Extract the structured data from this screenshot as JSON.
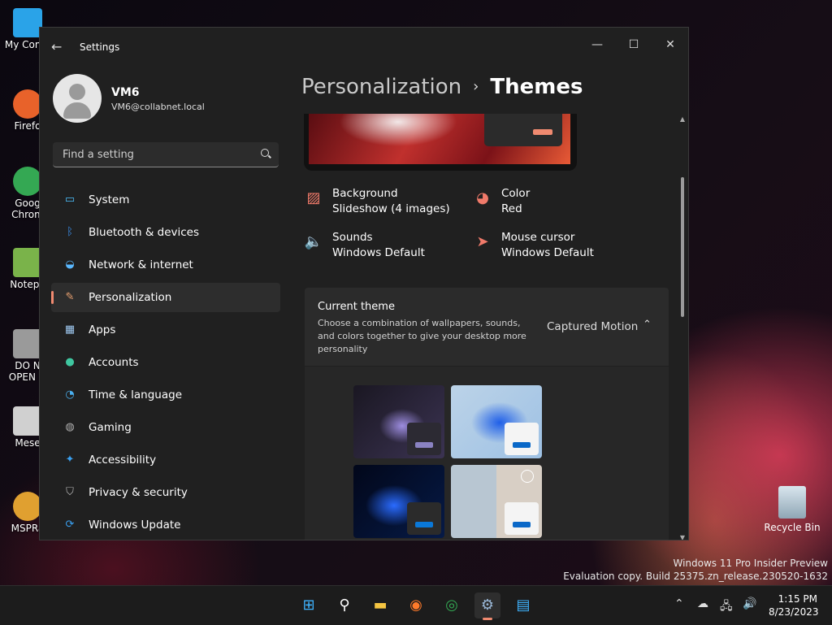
{
  "desktop": {
    "icons": [
      {
        "label": "My Comp",
        "color": "#2aa3e8"
      },
      {
        "label": "Firefo",
        "color": "#e8622a"
      },
      {
        "label": "Goog\nChrom",
        "color": "#34a853"
      },
      {
        "label": "Notepa",
        "color": "#7ab34a"
      },
      {
        "label": "DO N\nOPEN O",
        "color": "#9a9a9a"
      },
      {
        "label": "Mese",
        "color": "#d0d0d0"
      },
      {
        "label": "MSPRa",
        "color": "#e0a030"
      }
    ],
    "recycle_bin": "Recycle Bin",
    "watermark_line1": "Windows 11 Pro Insider Preview",
    "watermark_line2": "Evaluation copy. Build 25375.zn_release.230520-1632"
  },
  "window": {
    "title": "Settings",
    "back_icon": "back-arrow-icon",
    "minimize": "—",
    "maximize": "☐",
    "close": "✕"
  },
  "profile": {
    "name": "VM6",
    "email": "VM6@collabnet.local"
  },
  "search": {
    "placeholder": "Find a setting"
  },
  "nav": [
    {
      "label": "System",
      "icon": "system-icon",
      "glyph": "▭",
      "color": "#4cc2ff"
    },
    {
      "label": "Bluetooth & devices",
      "icon": "bluetooth-icon",
      "glyph": "ᛒ",
      "color": "#3b8eea"
    },
    {
      "label": "Network & internet",
      "icon": "wifi-icon",
      "glyph": "◒",
      "color": "#5ab8ff"
    },
    {
      "label": "Personalization",
      "icon": "brush-icon",
      "glyph": "✎",
      "color": "#e8a070"
    },
    {
      "label": "Apps",
      "icon": "apps-icon",
      "glyph": "▦",
      "color": "#9ec8f0"
    },
    {
      "label": "Accounts",
      "icon": "accounts-icon",
      "glyph": "●",
      "color": "#3fc7a0"
    },
    {
      "label": "Time & language",
      "icon": "globe-clock-icon",
      "glyph": "◔",
      "color": "#4ab0f0"
    },
    {
      "label": "Gaming",
      "icon": "gamepad-icon",
      "glyph": "◍",
      "color": "#b0b0b0"
    },
    {
      "label": "Accessibility",
      "icon": "accessibility-icon",
      "glyph": "✦",
      "color": "#3aa0f0"
    },
    {
      "label": "Privacy & security",
      "icon": "shield-icon",
      "glyph": "⛉",
      "color": "#b8b8b8"
    },
    {
      "label": "Windows Update",
      "icon": "update-icon",
      "glyph": "⟳",
      "color": "#3aa0f0"
    }
  ],
  "active_nav": "Personalization",
  "breadcrumb": {
    "parent": "Personalization",
    "separator": "›",
    "current": "Themes"
  },
  "attributes": [
    {
      "title": "Background",
      "value": "Slideshow (4 images)",
      "icon": "image-icon",
      "glyph": "▨"
    },
    {
      "title": "Color",
      "value": "Red",
      "icon": "palette-icon",
      "glyph": "◕"
    },
    {
      "title": "Sounds",
      "value": "Windows Default",
      "icon": "speaker-icon",
      "glyph": "🔈"
    },
    {
      "title": "Mouse cursor",
      "value": "Windows Default",
      "icon": "cursor-icon",
      "glyph": "➤"
    }
  ],
  "current_theme": {
    "title": "Current theme",
    "description": "Choose a combination of wallpapers, sounds, and colors together to give your desktop more personality",
    "value": "Captured Motion",
    "chevron": "⌃"
  },
  "taskbar": {
    "apps": [
      {
        "name": "start-icon",
        "glyph": "⊞",
        "color": "#3fb4ff"
      },
      {
        "name": "search-icon",
        "glyph": "⚲",
        "color": "#ffffff"
      },
      {
        "name": "file-explorer-icon",
        "glyph": "▬",
        "color": "#f5c542"
      },
      {
        "name": "firefox-icon",
        "glyph": "◉",
        "color": "#ff7a2a"
      },
      {
        "name": "chrome-icon",
        "glyph": "◎",
        "color": "#34a853"
      },
      {
        "name": "settings-icon",
        "glyph": "⚙",
        "color": "#9ab8d8"
      },
      {
        "name": "store-icon",
        "glyph": "▤",
        "color": "#3fb4ff"
      }
    ],
    "tray": [
      "⌃",
      "☁",
      "🖧",
      "🔊"
    ],
    "time": "1:15 PM",
    "date": "8/23/2023"
  },
  "colors": {
    "accent": "#f08a70",
    "window_bg": "#202020",
    "card_bg": "#2b2b2b"
  }
}
